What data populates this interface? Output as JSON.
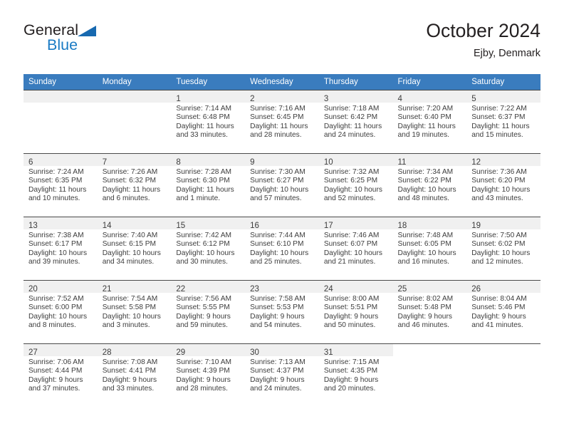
{
  "brand": {
    "name_part1": "General",
    "name_part2": "Blue",
    "mark": "triangle-logo",
    "color_primary": "#1a7bc4",
    "color_text": "#231f20"
  },
  "header": {
    "title": "October 2024",
    "subtitle": "Ejby, Denmark"
  },
  "theme": {
    "header_bg": "#3a7cbe",
    "header_text": "#ffffff",
    "shaded_cell_bg": "#f0f0f0",
    "grid_line": "#4a4a4a"
  },
  "weekdays": [
    "Sunday",
    "Monday",
    "Tuesday",
    "Wednesday",
    "Thursday",
    "Friday",
    "Saturday"
  ],
  "weeks": [
    [
      {
        "day": "",
        "sunrise": "",
        "sunset": "",
        "daylight_line1": "",
        "daylight_line2": "",
        "empty": true
      },
      {
        "day": "",
        "sunrise": "",
        "sunset": "",
        "daylight_line1": "",
        "daylight_line2": "",
        "empty": true
      },
      {
        "day": "1",
        "sunrise": "Sunrise: 7:14 AM",
        "sunset": "Sunset: 6:48 PM",
        "daylight_line1": "Daylight: 11 hours",
        "daylight_line2": "and 33 minutes."
      },
      {
        "day": "2",
        "sunrise": "Sunrise: 7:16 AM",
        "sunset": "Sunset: 6:45 PM",
        "daylight_line1": "Daylight: 11 hours",
        "daylight_line2": "and 28 minutes."
      },
      {
        "day": "3",
        "sunrise": "Sunrise: 7:18 AM",
        "sunset": "Sunset: 6:42 PM",
        "daylight_line1": "Daylight: 11 hours",
        "daylight_line2": "and 24 minutes."
      },
      {
        "day": "4",
        "sunrise": "Sunrise: 7:20 AM",
        "sunset": "Sunset: 6:40 PM",
        "daylight_line1": "Daylight: 11 hours",
        "daylight_line2": "and 19 minutes."
      },
      {
        "day": "5",
        "sunrise": "Sunrise: 7:22 AM",
        "sunset": "Sunset: 6:37 PM",
        "daylight_line1": "Daylight: 11 hours",
        "daylight_line2": "and 15 minutes."
      }
    ],
    [
      {
        "day": "6",
        "sunrise": "Sunrise: 7:24 AM",
        "sunset": "Sunset: 6:35 PM",
        "daylight_line1": "Daylight: 11 hours",
        "daylight_line2": "and 10 minutes."
      },
      {
        "day": "7",
        "sunrise": "Sunrise: 7:26 AM",
        "sunset": "Sunset: 6:32 PM",
        "daylight_line1": "Daylight: 11 hours",
        "daylight_line2": "and 6 minutes."
      },
      {
        "day": "8",
        "sunrise": "Sunrise: 7:28 AM",
        "sunset": "Sunset: 6:30 PM",
        "daylight_line1": "Daylight: 11 hours",
        "daylight_line2": "and 1 minute."
      },
      {
        "day": "9",
        "sunrise": "Sunrise: 7:30 AM",
        "sunset": "Sunset: 6:27 PM",
        "daylight_line1": "Daylight: 10 hours",
        "daylight_line2": "and 57 minutes."
      },
      {
        "day": "10",
        "sunrise": "Sunrise: 7:32 AM",
        "sunset": "Sunset: 6:25 PM",
        "daylight_line1": "Daylight: 10 hours",
        "daylight_line2": "and 52 minutes."
      },
      {
        "day": "11",
        "sunrise": "Sunrise: 7:34 AM",
        "sunset": "Sunset: 6:22 PM",
        "daylight_line1": "Daylight: 10 hours",
        "daylight_line2": "and 48 minutes."
      },
      {
        "day": "12",
        "sunrise": "Sunrise: 7:36 AM",
        "sunset": "Sunset: 6:20 PM",
        "daylight_line1": "Daylight: 10 hours",
        "daylight_line2": "and 43 minutes."
      }
    ],
    [
      {
        "day": "13",
        "sunrise": "Sunrise: 7:38 AM",
        "sunset": "Sunset: 6:17 PM",
        "daylight_line1": "Daylight: 10 hours",
        "daylight_line2": "and 39 minutes."
      },
      {
        "day": "14",
        "sunrise": "Sunrise: 7:40 AM",
        "sunset": "Sunset: 6:15 PM",
        "daylight_line1": "Daylight: 10 hours",
        "daylight_line2": "and 34 minutes."
      },
      {
        "day": "15",
        "sunrise": "Sunrise: 7:42 AM",
        "sunset": "Sunset: 6:12 PM",
        "daylight_line1": "Daylight: 10 hours",
        "daylight_line2": "and 30 minutes."
      },
      {
        "day": "16",
        "sunrise": "Sunrise: 7:44 AM",
        "sunset": "Sunset: 6:10 PM",
        "daylight_line1": "Daylight: 10 hours",
        "daylight_line2": "and 25 minutes."
      },
      {
        "day": "17",
        "sunrise": "Sunrise: 7:46 AM",
        "sunset": "Sunset: 6:07 PM",
        "daylight_line1": "Daylight: 10 hours",
        "daylight_line2": "and 21 minutes."
      },
      {
        "day": "18",
        "sunrise": "Sunrise: 7:48 AM",
        "sunset": "Sunset: 6:05 PM",
        "daylight_line1": "Daylight: 10 hours",
        "daylight_line2": "and 16 minutes."
      },
      {
        "day": "19",
        "sunrise": "Sunrise: 7:50 AM",
        "sunset": "Sunset: 6:02 PM",
        "daylight_line1": "Daylight: 10 hours",
        "daylight_line2": "and 12 minutes."
      }
    ],
    [
      {
        "day": "20",
        "sunrise": "Sunrise: 7:52 AM",
        "sunset": "Sunset: 6:00 PM",
        "daylight_line1": "Daylight: 10 hours",
        "daylight_line2": "and 8 minutes."
      },
      {
        "day": "21",
        "sunrise": "Sunrise: 7:54 AM",
        "sunset": "Sunset: 5:58 PM",
        "daylight_line1": "Daylight: 10 hours",
        "daylight_line2": "and 3 minutes."
      },
      {
        "day": "22",
        "sunrise": "Sunrise: 7:56 AM",
        "sunset": "Sunset: 5:55 PM",
        "daylight_line1": "Daylight: 9 hours",
        "daylight_line2": "and 59 minutes."
      },
      {
        "day": "23",
        "sunrise": "Sunrise: 7:58 AM",
        "sunset": "Sunset: 5:53 PM",
        "daylight_line1": "Daylight: 9 hours",
        "daylight_line2": "and 54 minutes."
      },
      {
        "day": "24",
        "sunrise": "Sunrise: 8:00 AM",
        "sunset": "Sunset: 5:51 PM",
        "daylight_line1": "Daylight: 9 hours",
        "daylight_line2": "and 50 minutes."
      },
      {
        "day": "25",
        "sunrise": "Sunrise: 8:02 AM",
        "sunset": "Sunset: 5:48 PM",
        "daylight_line1": "Daylight: 9 hours",
        "daylight_line2": "and 46 minutes."
      },
      {
        "day": "26",
        "sunrise": "Sunrise: 8:04 AM",
        "sunset": "Sunset: 5:46 PM",
        "daylight_line1": "Daylight: 9 hours",
        "daylight_line2": "and 41 minutes."
      }
    ],
    [
      {
        "day": "27",
        "sunrise": "Sunrise: 7:06 AM",
        "sunset": "Sunset: 4:44 PM",
        "daylight_line1": "Daylight: 9 hours",
        "daylight_line2": "and 37 minutes."
      },
      {
        "day": "28",
        "sunrise": "Sunrise: 7:08 AM",
        "sunset": "Sunset: 4:41 PM",
        "daylight_line1": "Daylight: 9 hours",
        "daylight_line2": "and 33 minutes."
      },
      {
        "day": "29",
        "sunrise": "Sunrise: 7:10 AM",
        "sunset": "Sunset: 4:39 PM",
        "daylight_line1": "Daylight: 9 hours",
        "daylight_line2": "and 28 minutes."
      },
      {
        "day": "30",
        "sunrise": "Sunrise: 7:13 AM",
        "sunset": "Sunset: 4:37 PM",
        "daylight_line1": "Daylight: 9 hours",
        "daylight_line2": "and 24 minutes."
      },
      {
        "day": "31",
        "sunrise": "Sunrise: 7:15 AM",
        "sunset": "Sunset: 4:35 PM",
        "daylight_line1": "Daylight: 9 hours",
        "daylight_line2": "and 20 minutes."
      },
      {
        "day": "",
        "sunrise": "",
        "sunset": "",
        "daylight_line1": "",
        "daylight_line2": "",
        "empty": true,
        "plain": true
      },
      {
        "day": "",
        "sunrise": "",
        "sunset": "",
        "daylight_line1": "",
        "daylight_line2": "",
        "empty": true,
        "plain": true
      }
    ]
  ]
}
